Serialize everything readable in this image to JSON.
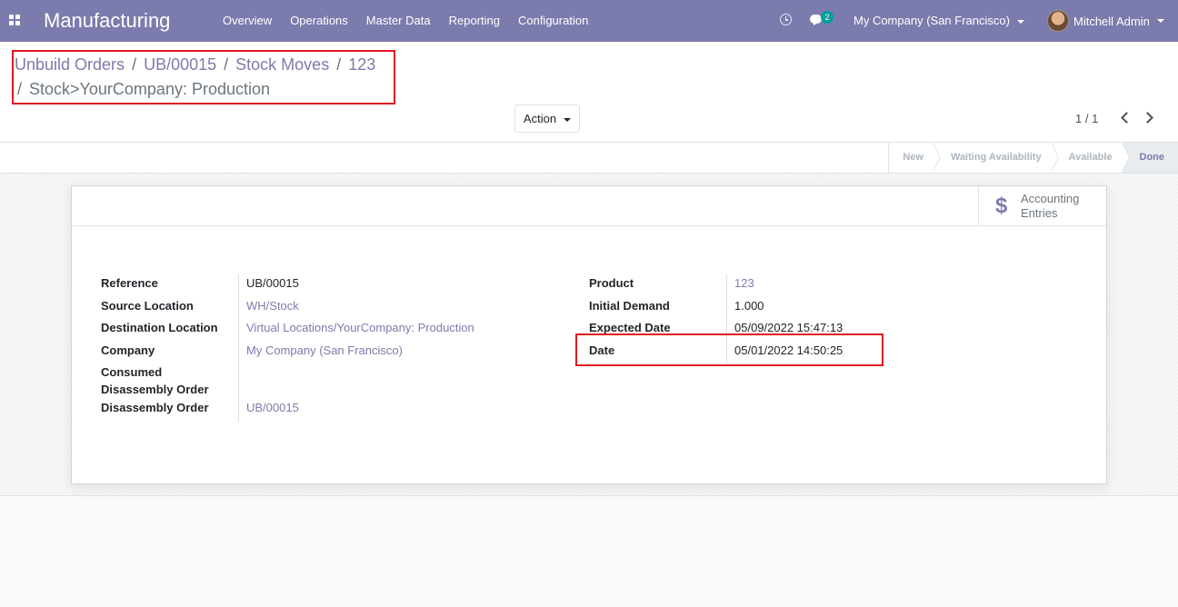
{
  "navbar": {
    "brand": "Manufacturing",
    "menu": [
      "Overview",
      "Operations",
      "Master Data",
      "Reporting",
      "Configuration"
    ],
    "chat_count": "2",
    "company": "My Company (San Francisco)",
    "user": "Mitchell Admin"
  },
  "breadcrumb": {
    "items": [
      "Unbuild Orders",
      "UB/00015",
      "Stock Moves",
      "123"
    ],
    "active": "Stock>YourCompany: Production"
  },
  "control": {
    "action_label": "Action",
    "pager": "1 / 1"
  },
  "statusbar": {
    "stages": [
      "New",
      "Waiting Availability",
      "Available",
      "Done"
    ],
    "current": "Done"
  },
  "smart_button": {
    "label_line1": "Accounting",
    "label_line2": "Entries",
    "icon": "dollar-icon"
  },
  "form": {
    "left": {
      "reference_label": "Reference",
      "reference_value": "UB/00015",
      "source_location_label": "Source Location",
      "source_location_value": "WH/Stock",
      "destination_location_label": "Destination Location",
      "destination_location_value": "Virtual Locations/YourCompany: Production",
      "company_label": "Company",
      "company_value": "My Company (San Francisco)",
      "consumed_label_1": "Consumed",
      "consumed_label_2": "Disassembly Order",
      "consumed_value": "",
      "disassembly_label": "Disassembly Order",
      "disassembly_value": "UB/00015"
    },
    "right": {
      "product_label": "Product",
      "product_value": "123",
      "initial_demand_label": "Initial Demand",
      "initial_demand_value": "1.000",
      "expected_date_label": "Expected Date",
      "expected_date_value": "05/09/2022 15:47:13",
      "date_label": "Date",
      "date_value": "05/01/2022 14:50:25"
    }
  },
  "colors": {
    "brand": "#7c7bad",
    "highlight": "#e0171f"
  }
}
